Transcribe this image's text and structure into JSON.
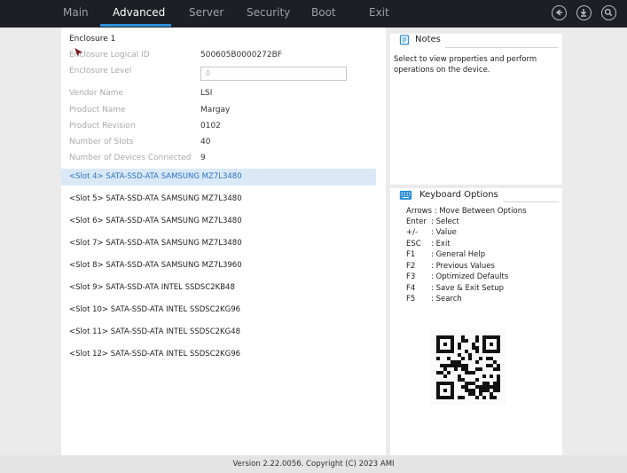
{
  "nav": {
    "tabs": [
      {
        "label": "Main"
      },
      {
        "label": "Advanced"
      },
      {
        "label": "Server"
      },
      {
        "label": "Security"
      },
      {
        "label": "Boot"
      },
      {
        "label": "Exit"
      }
    ],
    "active_tab": "Advanced",
    "icons": [
      "back-circle-icon",
      "download-circle-icon",
      "search-circle-icon"
    ]
  },
  "enclosure": {
    "title": "Enclosure 1",
    "fields": [
      {
        "label": "Enclosure Logical ID",
        "value": "500605B0000272BF"
      },
      {
        "label": "Enclosure Level",
        "value": "0"
      },
      {
        "label": "Vendor Name",
        "value": "LSI"
      },
      {
        "label": "Product Name",
        "value": "Margay"
      },
      {
        "label": "Product Revision",
        "value": "0102"
      },
      {
        "label": "Number of Slots",
        "value": "40"
      },
      {
        "label": "Number of Devices Connected",
        "value": "9"
      }
    ],
    "slots": [
      "<Slot  4> SATA-SSD-ATA SAMSUNG MZ7L3480",
      "<Slot  5> SATA-SSD-ATA SAMSUNG MZ7L3480",
      "<Slot  6> SATA-SSD-ATA SAMSUNG MZ7L3480",
      "<Slot  7> SATA-SSD-ATA SAMSUNG MZ7L3480",
      "<Slot  8> SATA-SSD-ATA SAMSUNG MZ7L3960",
      "<Slot  9> SATA-SSD-ATA INTEL SSDSC2KB48",
      "<Slot 10> SATA-SSD-ATA INTEL SSDSC2KG96",
      "<Slot 11> SATA-SSD-ATA INTEL SSDSC2KG48",
      "<Slot 12> SATA-SSD-ATA INTEL SSDSC2KG96"
    ],
    "selected_slot_index": 0
  },
  "notes": {
    "title": "Notes",
    "text": "Select to view properties and perform operations on the device."
  },
  "keyboard": {
    "title": "Keyboard Options",
    "lines": [
      {
        "key": "Arrows",
        "desc": ": Move Between Options"
      },
      {
        "key": "Enter",
        "desc": ": Select"
      },
      {
        "key": "+/-",
        "desc": ": Value"
      },
      {
        "key": "ESC",
        "desc": ": Exit"
      },
      {
        "key": "F1",
        "desc": ": General Help"
      },
      {
        "key": "F2",
        "desc": ": Previous Values"
      },
      {
        "key": "F3",
        "desc": ": Optimized Defaults"
      },
      {
        "key": "F4",
        "desc": ": Save & Exit Setup"
      },
      {
        "key": "F5",
        "desc": ": Search"
      }
    ]
  },
  "footer": {
    "text": "Version 2.22.0056. Copyright (C) 2023 AMI"
  },
  "colors": {
    "topbar": "#1c1f24",
    "accent": "#2c8ed6",
    "selected_row_bg": "#dbe9f7",
    "selected_row_text": "#2a72c2"
  }
}
